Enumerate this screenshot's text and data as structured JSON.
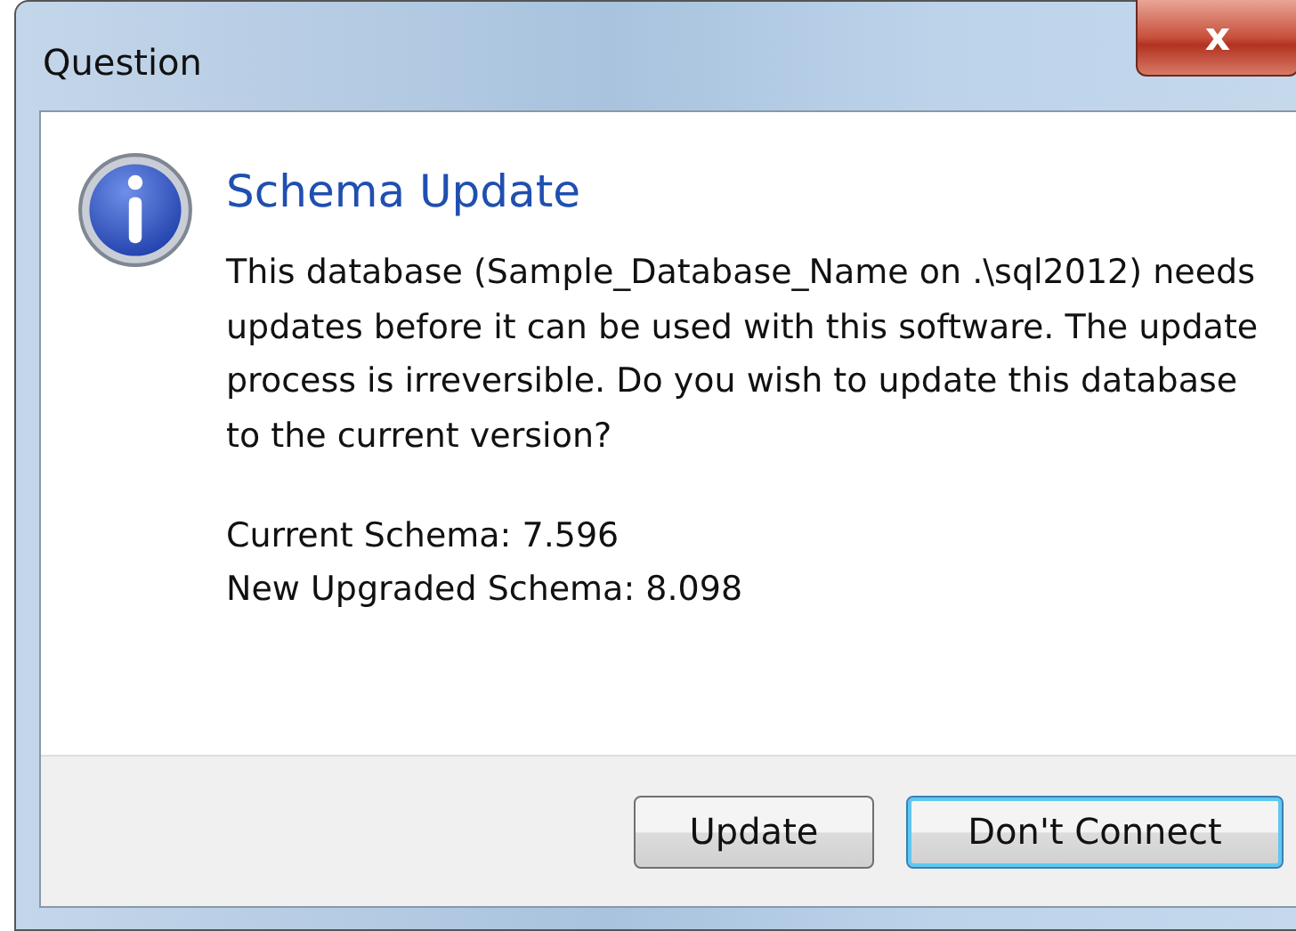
{
  "window": {
    "title": "Question",
    "close": "x"
  },
  "heading": "Schema Update",
  "message": "This database (Sample_Database_Name on .\\sql2012) needs updates before it can be used with this software. The update process is irreversible.  Do you wish to update this database to the current version?",
  "details": [
    "Current Schema: 7.596",
    "New Upgraded Schema: 8.098"
  ],
  "buttons": [
    {
      "label": "Update",
      "default": false
    },
    {
      "label": "Don't Connect",
      "default": true
    }
  ]
}
